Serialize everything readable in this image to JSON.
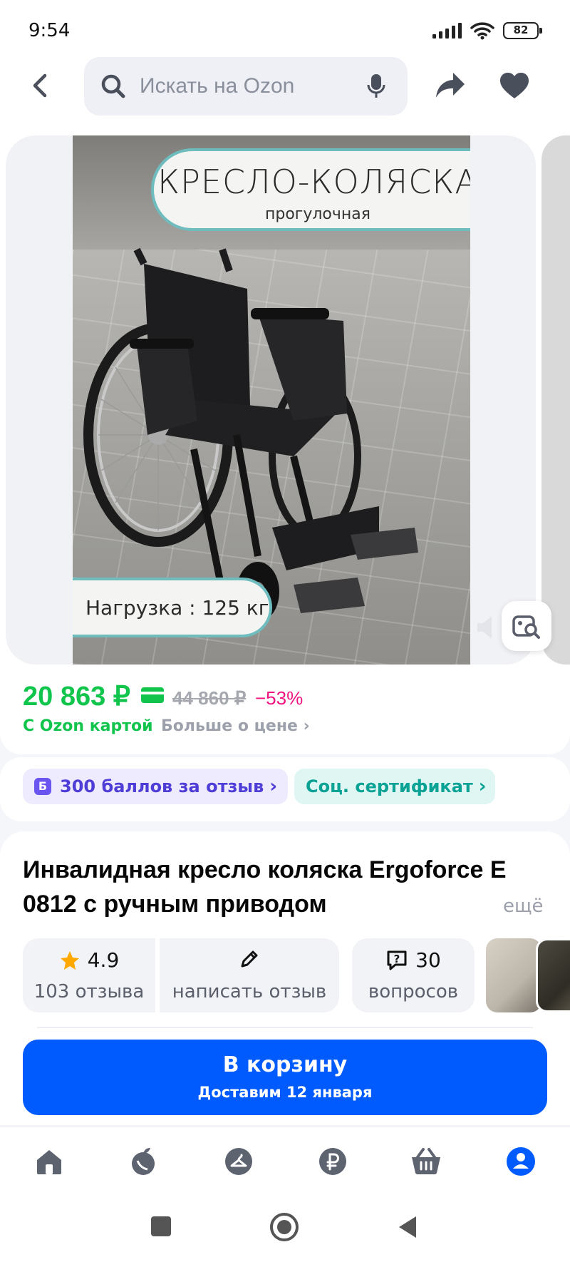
{
  "status_bar": {
    "time": "9:54",
    "battery": "82"
  },
  "header": {
    "search_placeholder": "Искать на Ozon"
  },
  "gallery": {
    "banner_title": "КРЕСЛО-КОЛЯСКА",
    "banner_subtitle": "прогулочная",
    "banner_load": "Нагрузка : 125 кг"
  },
  "price": {
    "current": "20 863 ₽",
    "old": "44 860 ₽",
    "discount": "−53%",
    "card_label": "С Ozon картой",
    "more_label": "Больше о цене ›"
  },
  "chips": {
    "points_icon": "Б",
    "points": "300 баллов за отзыв",
    "certificate": "Соц. сертификат"
  },
  "product": {
    "title": "Инвалидная кресло коляска Ergoforce E 0812 с ручным приводом",
    "more": "ещё",
    "rating": "4.9",
    "reviews": "103 отзыва",
    "write_review": "написать отзыв",
    "questions_count": "30",
    "questions": "вопросов"
  },
  "cart": {
    "label": "В корзину",
    "delivery": "Доставим 12 января"
  },
  "colors": {
    "accent": "#005bff",
    "price_green": "#10c44c",
    "discount_pink": "#f1117e"
  },
  "icons": {
    "header": [
      "back-arrow-icon",
      "search-icon",
      "microphone-icon",
      "share-icon",
      "heart-icon"
    ],
    "nav": [
      "home-icon",
      "fresh-icon",
      "hanger-icon",
      "ruble-icon",
      "basket-icon",
      "profile-icon"
    ]
  }
}
